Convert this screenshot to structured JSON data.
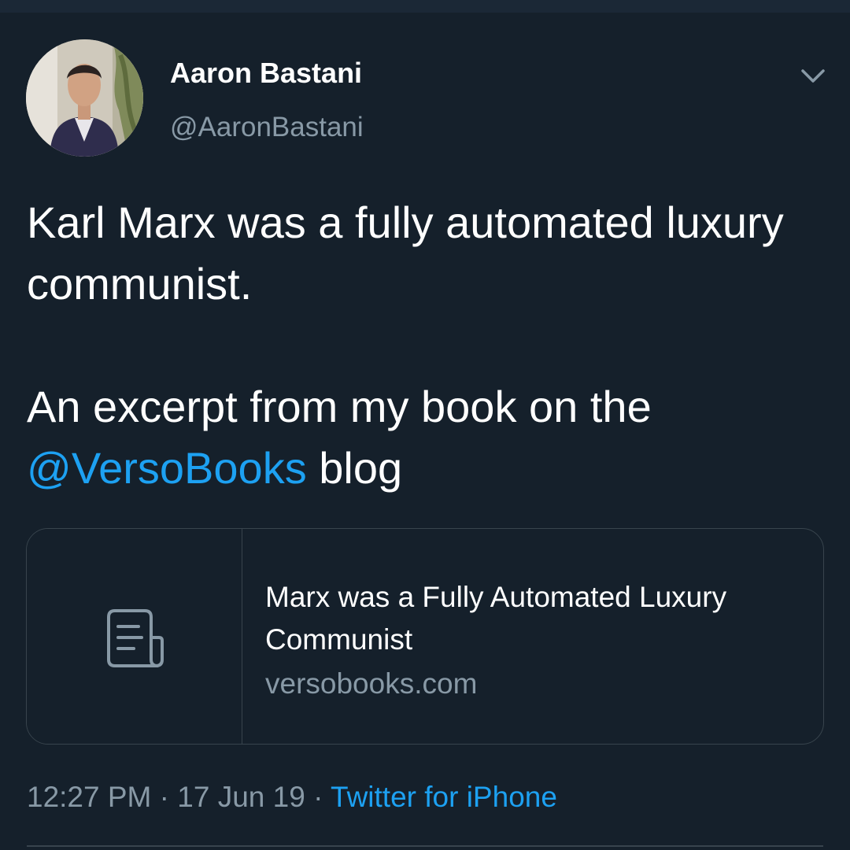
{
  "tweet": {
    "author": {
      "display_name": "Aaron Bastani",
      "handle": "@AaronBastani"
    },
    "text": {
      "line1": "Karl Marx was a fully automated luxury communist.",
      "line2_prefix": "An excerpt from my book on the",
      "mention": "@VersoBooks",
      "line2_suffix": " blog"
    },
    "card": {
      "title": "Marx was a Fully Automated Luxury Communist",
      "domain": "versobooks.com",
      "thumbnail_icon": "document-icon"
    },
    "meta": {
      "time": "12:27 PM",
      "separator": " · ",
      "date": "17 Jun 19",
      "source": "Twitter for iPhone"
    }
  },
  "colors": {
    "background": "#15202b",
    "accent": "#1da1f2",
    "secondary_text": "#8899a6",
    "border": "#38444d"
  }
}
